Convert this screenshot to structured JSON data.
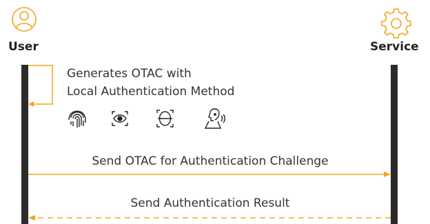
{
  "actors": {
    "user": {
      "label": "User",
      "icon": "user-icon"
    },
    "service": {
      "label": "Service",
      "icon": "gear-icon"
    }
  },
  "steps": {
    "local": {
      "line1": "Generates OTAC with",
      "line2": "Local Authentication Method",
      "methods": [
        "fingerprint-icon",
        "eye-scan-icon",
        "face-scan-icon",
        "voice-icon"
      ]
    },
    "send_otac": "Send OTAC for Authentication Challenge",
    "send_result": "Send Authentication Result"
  },
  "colors": {
    "accent": "#F2A51B",
    "lifeline": "#2B2B2B",
    "text": "#333333"
  }
}
